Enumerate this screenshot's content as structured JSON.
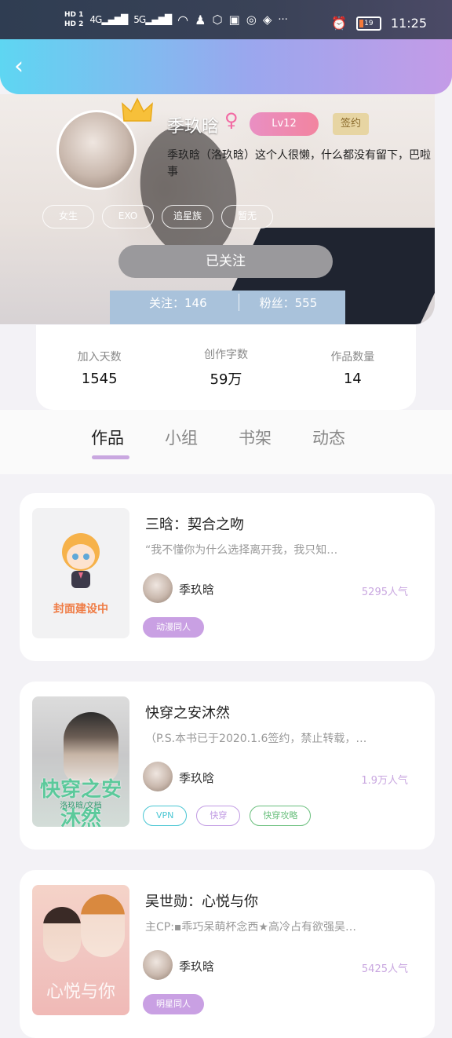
{
  "status_bar": {
    "hd1": "HD 1",
    "hd2": "HD 2",
    "net1": "4G",
    "net2": "5G",
    "battery": "19",
    "time": "11:25"
  },
  "header": {
    "back_icon": "chevron-left-icon"
  },
  "profile": {
    "name": "季玖晗",
    "gender_symbol": "♀",
    "level": "Lv12",
    "badge": "签约",
    "bio": "季玖晗（洛玖晗）这个人很懒，什么都没有留下，巴啦事",
    "tags": [
      "女生",
      "EXO",
      "追星族",
      "暂无"
    ],
    "follow_button": "已关注",
    "following_label": "关注：146",
    "fans_label": "粉丝：555"
  },
  "stats": [
    {
      "label": "加入天数",
      "value": "1545"
    },
    {
      "label": "创作字数",
      "value": "59万"
    },
    {
      "label": "作品数量",
      "value": "14"
    }
  ],
  "tabs": [
    "作品",
    "小组",
    "书架",
    "动态"
  ],
  "works": [
    {
      "cover_text": "封面建设中",
      "title": "三晗：契合之吻",
      "desc": "“我不懂你为什么选择离开我，我只知…",
      "author": "季玖晗",
      "popularity": "5295人气",
      "tags": [
        {
          "text": "动漫同人",
          "style": "fill"
        }
      ]
    },
    {
      "cover_text": "快穿之安沐然",
      "cover_sub": "洛玖晗/文档",
      "title": "快穿之安沐然",
      "desc": "（P.S.本书已于2020.1.6签约，禁止转载，…",
      "author": "季玖晗",
      "popularity": "1.9万人气",
      "tags": [
        {
          "text": "VPN",
          "style": "cyan"
        },
        {
          "text": "快穿",
          "style": "purple"
        },
        {
          "text": "快穿攻略",
          "style": "green"
        }
      ]
    },
    {
      "cover_text": "心悦与你",
      "title": "吴世勋：心悦与你",
      "desc": "主CP:▪乖巧呆萌杯念西★高冷占有欲强吴…",
      "author": "季玖晗",
      "popularity": "5425人气",
      "tags": [
        {
          "text": "明星同人",
          "style": "fill"
        }
      ]
    }
  ],
  "colors": {
    "header_start": "#5ed6f2",
    "header_end": "#c49be7",
    "accent": "#c9a7e0",
    "level_pink": "#f2849f"
  }
}
